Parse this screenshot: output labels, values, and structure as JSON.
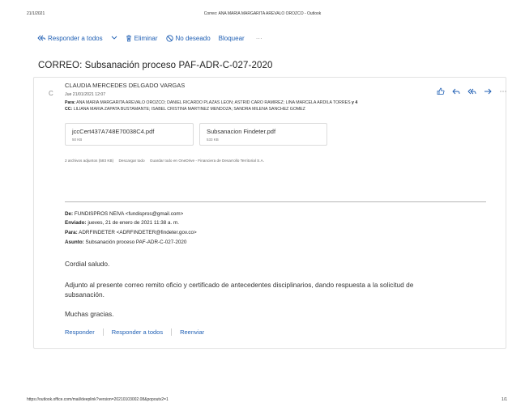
{
  "print_header": {
    "date": "21/1/2021",
    "title": "Correo: ANA MARIA MARGARITA AREVALO OROZCO - Outlook"
  },
  "toolbar": {
    "reply_all": "Responder a todos",
    "delete": "Eliminar",
    "junk": "No deseado",
    "block": "Bloquear",
    "more": "···"
  },
  "subject": "CORREO: Subsanación proceso PAF-ADR-C-027-2020",
  "message": {
    "avatar_letter": "C",
    "sender": "CLAUDIA MERCEDES DELGADO VARGAS",
    "date": "Jue 21/01/2021 12:07",
    "to_label": "Para:",
    "to_value": "ANA MARIA MARGARITA AREVALO OROZCO; DANIEL RICARDO PLAZAS LEON; ASTRID CARO RAMIREZ; LINA MARCELA ARDILA TORRES",
    "to_more": "y 4",
    "cc_label": "CC:",
    "cc_value": "LILIANA MARIA ZAPATA BUSTAMANTE; ISABEL CRISTINA MARTINEZ MENDOZA; SANDRA MILENA SANCHEZ GOMEZ"
  },
  "attachments": [
    {
      "name": "jccCert437A748E70038C4.pdf",
      "size": "50 KB"
    },
    {
      "name": "Subsanacion Findeter.pdf",
      "size": "533 KB"
    }
  ],
  "attachments_info": {
    "count": "2 archivos adjuntos (583 KB)",
    "download_all": "Descargar todo",
    "save_all": "Guardar todo en OneDrive - Financiera de Desarrollo Territorial S.A."
  },
  "forwarded": {
    "from_label": "De:",
    "from_value": "FUNDISPROS NEIVA <fundispros@gmail.com>",
    "sent_label": "Enviado:",
    "sent_value": "jueves, 21 de enero de 2021 11:38 a. m.",
    "to_label": "Para:",
    "to_value": "ADRFINDETER <ADRFINDETER@findeter.gov.co>",
    "subject_label": "Asunto:",
    "subject_value": "Subsanación proceso PAF-ADR-C-027-2020"
  },
  "body": {
    "greeting": "Cordial saludo.",
    "paragraph": "Adjunto al presente correo remito oficio y certificado de antecedentes disciplinarios, dando respuesta a la solicitud de subsanación.",
    "closing": "Muchas gracias."
  },
  "reply_links": {
    "reply": "Responder",
    "reply_all": "Responder a todos",
    "forward": "Reenviar"
  },
  "print_footer": {
    "url": "https://outlook.office.com/mail/deeplink?version=20210103002.08&popoutv2=1",
    "page": "1/1"
  },
  "colors": {
    "accent": "#1f5fb4"
  }
}
